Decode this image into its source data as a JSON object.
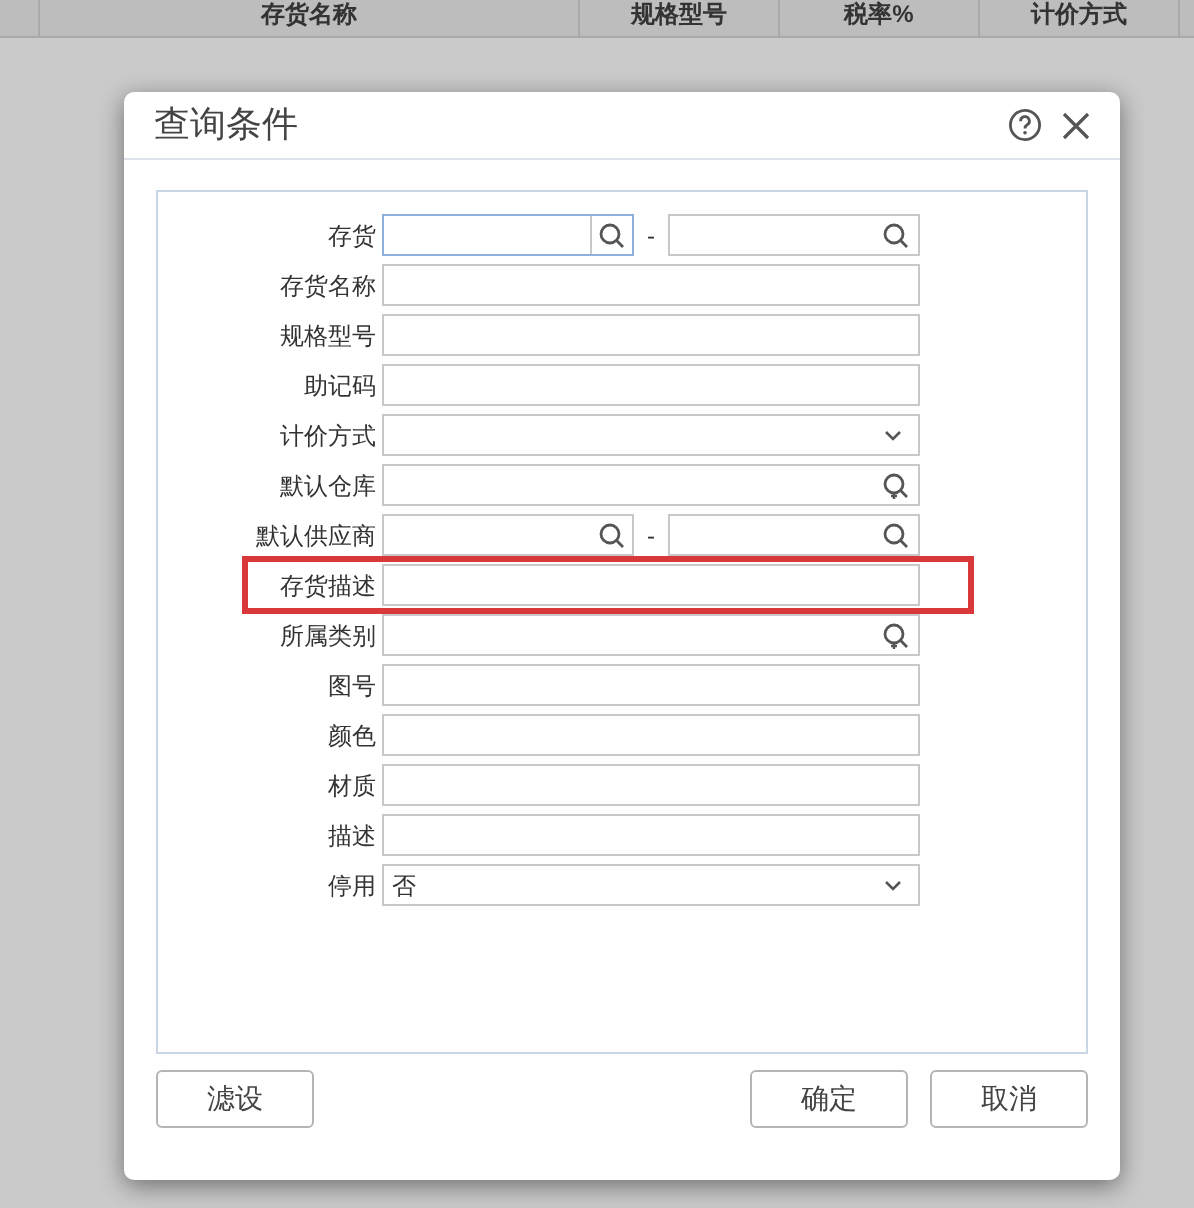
{
  "background_table": {
    "columns": [
      "存货名称",
      "规格型号",
      "税率%",
      "计价方式"
    ]
  },
  "dialog": {
    "title": "查询条件",
    "fields": [
      {
        "kind": "range",
        "label": "存货",
        "separator": "-",
        "focused": true,
        "highlighted": false
      },
      {
        "kind": "text",
        "label": "存货名称",
        "highlighted": false
      },
      {
        "kind": "text",
        "label": "规格型号",
        "highlighted": false
      },
      {
        "kind": "text",
        "label": "助记码",
        "highlighted": false
      },
      {
        "kind": "select",
        "label": "计价方式",
        "highlighted": false
      },
      {
        "kind": "lookup",
        "label": "默认仓库",
        "highlighted": false
      },
      {
        "kind": "range",
        "label": "默认供应商",
        "separator": "-",
        "focused": false,
        "highlighted": false
      },
      {
        "kind": "text",
        "label": "存货描述",
        "highlighted": true
      },
      {
        "kind": "lookup",
        "label": "所属类别",
        "highlighted": false
      },
      {
        "kind": "text",
        "label": "图号",
        "highlighted": false
      },
      {
        "kind": "text",
        "label": "颜色",
        "highlighted": false
      },
      {
        "kind": "text",
        "label": "材质",
        "highlighted": false
      },
      {
        "kind": "text",
        "label": "描述",
        "highlighted": false
      },
      {
        "kind": "select",
        "label": "停用",
        "value": "否",
        "highlighted": false
      }
    ],
    "buttons": {
      "left": "滤设",
      "ok": "确定",
      "cancel": "取消"
    }
  }
}
